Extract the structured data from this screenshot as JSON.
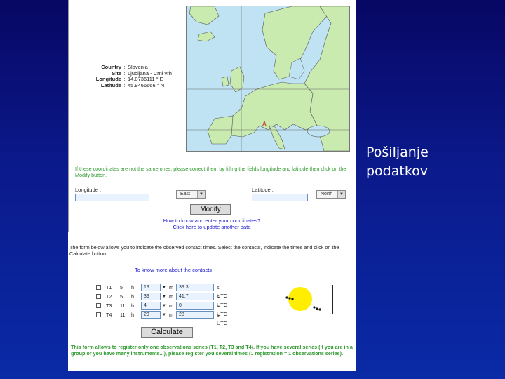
{
  "caption": {
    "line1": "Pošiljanje",
    "line2": "podatkov"
  },
  "site": {
    "rows": [
      {
        "label": "Country",
        "value": "Slovenia"
      },
      {
        "label": "Site",
        "value": "Ljubljana - Crni vrh"
      },
      {
        "label": "Longitude",
        "value": "14.0736111 ° E"
      },
      {
        "label": "Latitude",
        "value": "45.9466666 ° N"
      }
    ]
  },
  "map": {
    "marker": "A",
    "accent": "#c63b2f",
    "land": "#c9ebb0",
    "sea": "#bfe3f2"
  },
  "coords_form": {
    "warning": "If these coordinates are not the same ones, please correct them by filling the fields longitude and latitude then click on the Modify button.",
    "longitude_label": "Longitude :",
    "latitude_label": "Latitude :",
    "east_value": "East",
    "north_value": "North",
    "modify_button": "Modify",
    "howto_link": "How to know and enter your coordinates?",
    "update_link": "Click here to update another data"
  },
  "contacts": {
    "intro": "The form below allows you to indicate the observed contact times. Select the contacts, indicate the times and click on the Calculate button.",
    "more_link": "To know more about the contacts",
    "sep_h": "h",
    "sep_m": "m",
    "utc": "s UTC",
    "rows": [
      {
        "label": "T1",
        "hour": "5",
        "min": "19",
        "sec": "39.3"
      },
      {
        "label": "T2",
        "hour": "5",
        "min": "39",
        "sec": "41.7"
      },
      {
        "label": "T3",
        "hour": "11",
        "min": "4",
        "sec": "0"
      },
      {
        "label": "T4",
        "hour": "11",
        "min": "23",
        "sec": "28"
      }
    ],
    "calc_button": "Calculate",
    "note": "This form allows to register only one observations series (T1, T2, T3 and T4). If you have several series (if you are in a group or you have many instruments...), please register you several times (1 registration = 1 observations series)."
  }
}
